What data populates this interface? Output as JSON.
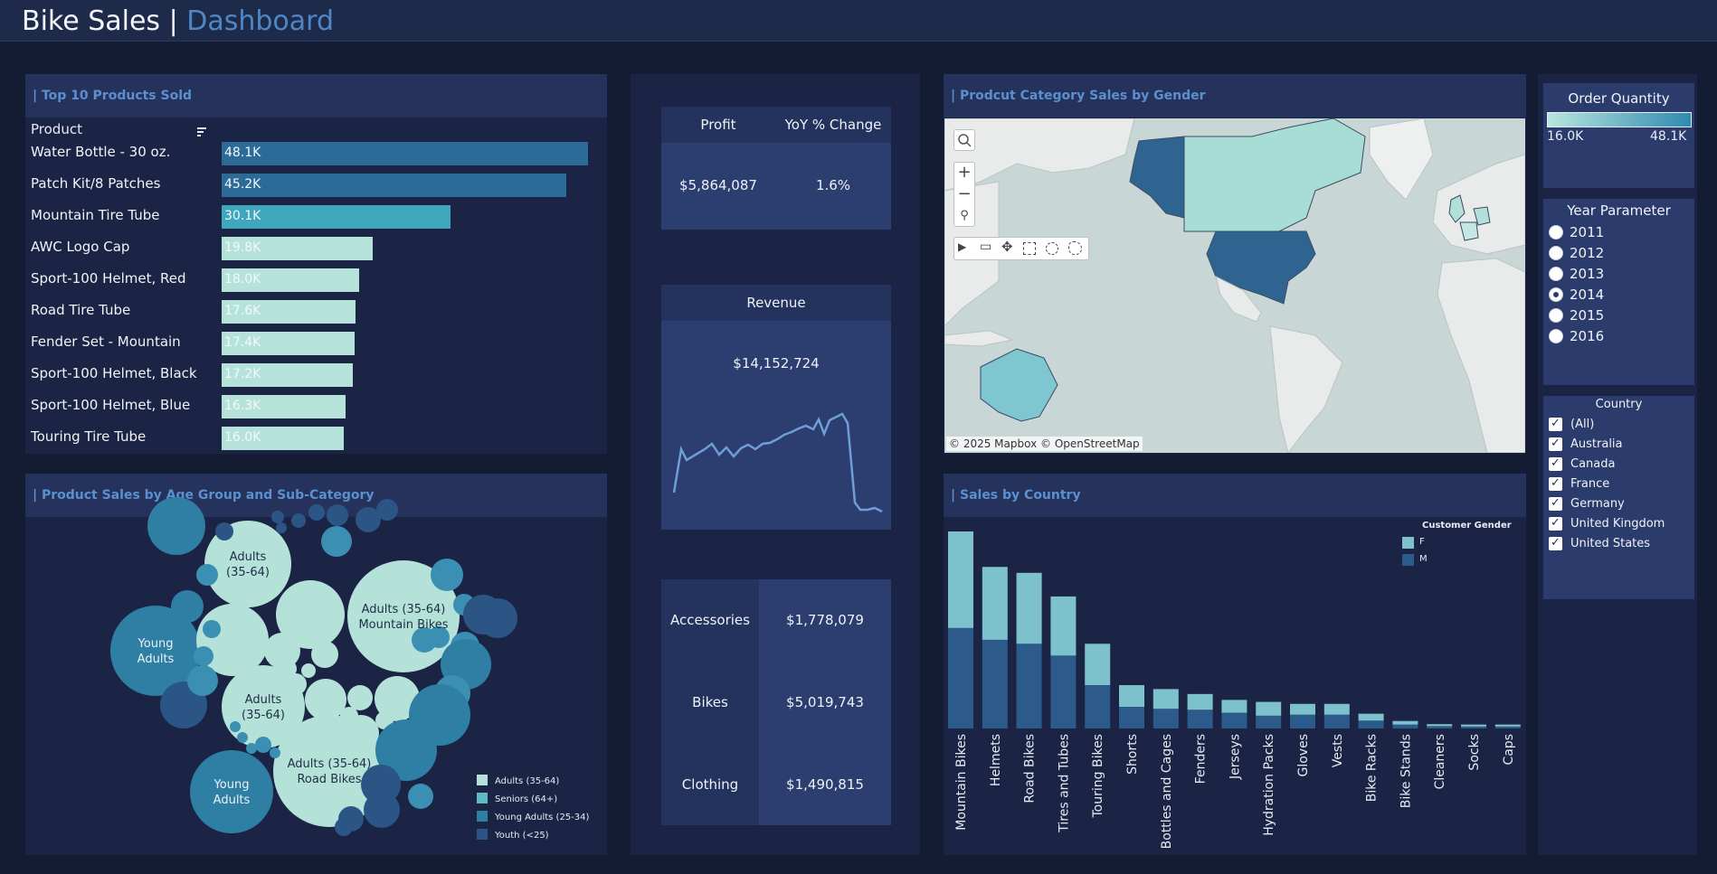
{
  "header": {
    "title_main": "Bike Sales",
    "title_sep": "|",
    "title_accent": "Dashboard"
  },
  "colors": {
    "light": "#b4e2d9",
    "mid": "#4da9bd",
    "teal": "#3184a8",
    "dark": "#2c5c8e",
    "female": "#7cc1cc",
    "male": "#2b5a8b"
  },
  "top_products": {
    "title": "| Top 10 Products Sold",
    "column_header": "Product",
    "sort_icon": "sort-icon",
    "rows": [
      {
        "name": "Water Bottle - 30 oz.",
        "value_label": "48.1K",
        "value": 48.1
      },
      {
        "name": "Patch Kit/8 Patches",
        "value_label": "45.2K",
        "value": 45.2
      },
      {
        "name": "Mountain Tire Tube",
        "value_label": "30.1K",
        "value": 30.1
      },
      {
        "name": "AWC Logo Cap",
        "value_label": "19.8K",
        "value": 19.8
      },
      {
        "name": "Sport-100 Helmet, Red",
        "value_label": "18.0K",
        "value": 18.0
      },
      {
        "name": "Road Tire Tube",
        "value_label": "17.6K",
        "value": 17.6
      },
      {
        "name": "Fender Set - Mountain",
        "value_label": "17.4K",
        "value": 17.4
      },
      {
        "name": "Sport-100 Helmet, Black",
        "value_label": "17.2K",
        "value": 17.2
      },
      {
        "name": "Sport-100 Helmet, Blue",
        "value_label": "16.3K",
        "value": 16.3
      },
      {
        "name": "Touring Tire Tube",
        "value_label": "16.0K",
        "value": 16.0
      }
    ]
  },
  "age_group": {
    "title": "| Product Sales by Age Group and Sub-Category",
    "bubble_labels": {
      "adults_top": [
        "Adults",
        "(35-64)"
      ],
      "adults_mtb": [
        "Adults (35-64)",
        "Mountain Bikes"
      ],
      "young_left": [
        "Young",
        "Adults"
      ],
      "adults_mid": [
        "Adults",
        "(35-64)"
      ],
      "adults_road": [
        "Adults (35-64)",
        "Road Bikes"
      ],
      "young_bottom": [
        "Young",
        "Adults"
      ]
    },
    "legend": [
      "Adults (35-64)",
      "Seniors (64+)",
      "Young Adults (25-34)",
      "Youth (<25)"
    ]
  },
  "kpi": {
    "profit_label": "Profit",
    "yoy_label": "YoY % Change",
    "profit_value": "$5,864,087",
    "yoy_value": "1.6%",
    "revenue_label": "Revenue",
    "revenue_value": "$14,152,724",
    "categories": [
      {
        "name": "Accessories",
        "value": "$1,778,079"
      },
      {
        "name": "Bikes",
        "value": "$5,019,743"
      },
      {
        "name": "Clothing",
        "value": "$1,490,815"
      }
    ]
  },
  "map": {
    "title": "| Prodcut Category Sales by Gender",
    "attribution": "© 2025 Mapbox © OpenStreetMap"
  },
  "sales_country": {
    "title": "| Sales by Country",
    "legend_title": "Customer Gender",
    "legend": [
      "F",
      "M"
    ]
  },
  "chart_data": {
    "type": "bar",
    "categories": [
      "Mountain Bikes",
      "Helmets",
      "Road Bikes",
      "Tires and Tubes",
      "Touring Bikes",
      "Shorts",
      "Bottles and Cages",
      "Fenders",
      "Jerseys",
      "Hydration Packs",
      "Gloves",
      "Vests",
      "Bike Racks",
      "Bike Stands",
      "Cleaners",
      "Socks",
      "Caps"
    ],
    "series": [
      {
        "name": "M",
        "values": [
          51,
          45,
          43,
          37,
          22,
          11,
          10,
          9.5,
          8,
          6.5,
          7,
          7,
          4,
          2,
          1.2,
          1,
          1
        ]
      },
      {
        "name": "F",
        "values": [
          49,
          37,
          36,
          30,
          21,
          11,
          10,
          8,
          6.5,
          7,
          5.5,
          5.5,
          3.5,
          1.8,
          1,
          1,
          1
        ]
      }
    ],
    "stacked": true,
    "legend_placement": "top-right",
    "grid": false
  },
  "sidebar": {
    "order_qty_title": "Order Quantity",
    "order_qty_min": "16.0K",
    "order_qty_max": "48.1K",
    "year_title": "Year Parameter",
    "years": [
      "2011",
      "2012",
      "2013",
      "2014",
      "2015",
      "2016"
    ],
    "selected_year": "2014",
    "country_title": "Country",
    "countries": [
      "(All)",
      "Australia",
      "Canada",
      "France",
      "Germany",
      "United Kingdom",
      "United States"
    ]
  },
  "map_tools": [
    "search-icon",
    "zoom-in-icon",
    "zoom-out-icon",
    "pin-icon",
    "play-icon",
    "select-icon",
    "pan-icon",
    "rect-select-icon",
    "lasso-icon",
    "radial-select-icon"
  ]
}
